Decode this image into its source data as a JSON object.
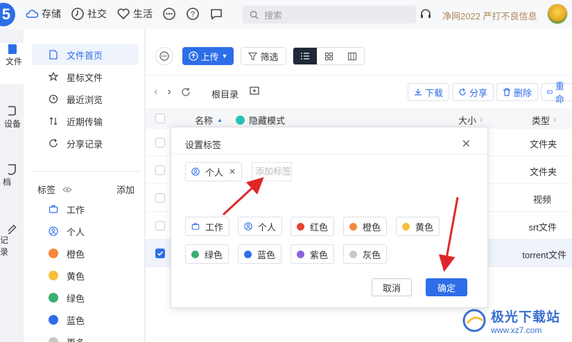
{
  "topbar": {
    "logo": "5",
    "nav": [
      {
        "label": "存储",
        "icon": "cloud-icon"
      },
      {
        "label": "社交",
        "icon": "clock-icon"
      },
      {
        "label": "生活",
        "icon": "heart-icon"
      }
    ],
    "search_placeholder": "搜索",
    "promo": "净网2022 严打不良信息"
  },
  "strip": {
    "items": [
      {
        "label": "文件",
        "icon": "files-icon"
      },
      {
        "label": "设备",
        "icon": "device-icon"
      },
      {
        "label": "档",
        "icon": "shield-doc-icon"
      },
      {
        "label": "记录",
        "icon": "edit-icon"
      }
    ]
  },
  "sidebar": {
    "menu": [
      {
        "label": "文件首页",
        "icon": "file-icon"
      },
      {
        "label": "星标文件",
        "icon": "star-icon"
      },
      {
        "label": "最近浏览",
        "icon": "history-icon"
      },
      {
        "label": "近期传输",
        "icon": "transfer-icon"
      },
      {
        "label": "分享记录",
        "icon": "share-record-icon"
      }
    ],
    "tags_title": "标签",
    "tags_add": "添加",
    "tags": [
      {
        "label": "工作",
        "color": "#2d6ee8"
      },
      {
        "label": "个人",
        "color": "#2d6ee8"
      },
      {
        "label": "橙色",
        "color": "#f5883a"
      },
      {
        "label": "黄色",
        "color": "#f7bf3a"
      },
      {
        "label": "绿色",
        "color": "#38b06f"
      },
      {
        "label": "蓝色",
        "color": "#2d6ee8"
      },
      {
        "label": "更多",
        "color": "#c8c8c8"
      }
    ]
  },
  "toolbar": {
    "upload": "上传",
    "filter": "筛选"
  },
  "breadcrumb": {
    "root": "根目录"
  },
  "actions": {
    "download": "下载",
    "share": "分享",
    "delete": "删除",
    "rename": "重命"
  },
  "table": {
    "col_name": "名称",
    "hidden_mode": "隐藏模式",
    "col_size": "大小",
    "col_type": "类型",
    "rows": [
      {
        "type": "文件夹"
      },
      {
        "type": "文件夹"
      },
      {
        "type": "视频"
      },
      {
        "type": "srt文件"
      },
      {
        "type": "torrent文件"
      }
    ]
  },
  "dialog": {
    "title": "设置标签",
    "selected_tag": "个人",
    "input_placeholder": "添加标签",
    "tags": [
      {
        "label": "工作",
        "color": "#2d6ee8"
      },
      {
        "label": "个人",
        "color": "#2d6ee8"
      },
      {
        "label": "红色",
        "color": "#e8433a"
      },
      {
        "label": "橙色",
        "color": "#f5883a"
      },
      {
        "label": "黄色",
        "color": "#f7bf3a"
      },
      {
        "label": "绿色",
        "color": "#38b06f"
      },
      {
        "label": "蓝色",
        "color": "#2d6ee8"
      },
      {
        "label": "紫色",
        "color": "#8b63e0"
      },
      {
        "label": "灰色",
        "color": "#c8c8c8"
      }
    ],
    "cancel": "取消",
    "ok": "确定"
  },
  "watermark": {
    "main": "极光下载站",
    "sub": "www.xz7.com"
  }
}
